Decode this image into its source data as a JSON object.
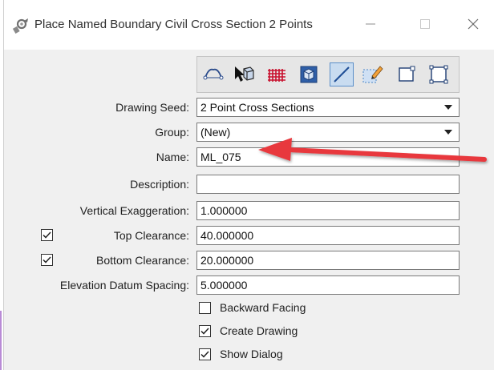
{
  "window": {
    "title": "Place Named Boundary Civil Cross Section 2 Points"
  },
  "titlebar_buttons": {
    "minimize": "—",
    "maximize": "☐",
    "close": "✕"
  },
  "toolbar": {
    "icons": [
      "civil-cross-section-icon",
      "select-element-icon",
      "grid-fence-icon",
      "3d-cube-icon",
      "line-two-points-icon",
      "dashed-box-pencil-icon",
      "box-corner-icon",
      "box-four-corners-icon"
    ],
    "active_index": 4
  },
  "form": {
    "drawing_seed": {
      "label": "Drawing Seed:",
      "value": "2 Point Cross Sections"
    },
    "group": {
      "label": "Group:",
      "value": "(New)"
    },
    "name": {
      "label": "Name:",
      "value": "ML_075"
    },
    "description": {
      "label": "Description:",
      "value": ""
    },
    "vertical_exaggeration": {
      "label": "Vertical Exaggeration:",
      "value": "1.000000"
    },
    "top_clearance": {
      "label": "Top Clearance:",
      "value": "40.000000",
      "checked": true
    },
    "bottom_clearance": {
      "label": "Bottom Clearance:",
      "value": "20.000000",
      "checked": true
    },
    "elevation_datum_spacing": {
      "label": "Elevation Datum Spacing:",
      "value": "5.000000"
    }
  },
  "options": {
    "backward_facing": {
      "label": "Backward Facing",
      "checked": false
    },
    "create_drawing": {
      "label": "Create Drawing",
      "checked": true
    },
    "show_dialog": {
      "label": "Show Dialog",
      "checked": true
    }
  },
  "annotation": {
    "arrow_color": "#e8383d"
  },
  "colors": {
    "active_tool": "#c9dcf0",
    "dialog_bg": "#f0f0f0"
  }
}
